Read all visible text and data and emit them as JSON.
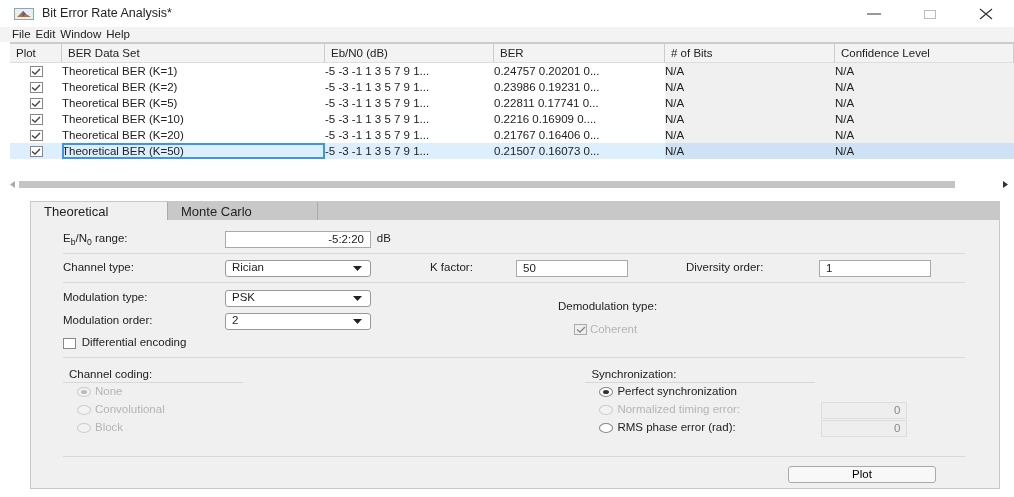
{
  "window": {
    "title": "Bit Error Rate Analysis*"
  },
  "menu": [
    "File",
    "Edit",
    "Window",
    "Help"
  ],
  "table": {
    "plot_column": "Plot",
    "columns": [
      "BER Data Set",
      "Eb/N0 (dB)",
      "BER",
      "# of Bits",
      "Confidence Level"
    ],
    "rows": [
      {
        "plot": true,
        "selected": false,
        "cells": [
          "Theoretical BER (K=1)",
          "-5 -3 -1 1 3 5 7 9 1...",
          "0.24757 0.20201 0...",
          "N/A",
          "N/A"
        ]
      },
      {
        "plot": true,
        "selected": false,
        "cells": [
          "Theoretical BER (K=2)",
          "-5 -3 -1 1 3 5 7 9 1...",
          "0.23986 0.19231 0...",
          "N/A",
          "N/A"
        ]
      },
      {
        "plot": true,
        "selected": false,
        "cells": [
          "Theoretical BER (K=5)",
          "-5 -3 -1 1 3 5 7 9 1...",
          "0.22811 0.17741 0...",
          "N/A",
          "N/A"
        ]
      },
      {
        "plot": true,
        "selected": false,
        "cells": [
          "Theoretical BER (K=10)",
          "-5 -3 -1 1 3 5 7 9 1...",
          "0.2216 0.16909 0....",
          "N/A",
          "N/A"
        ]
      },
      {
        "plot": true,
        "selected": false,
        "cells": [
          "Theoretical BER (K=20)",
          "-5 -3 -1 1 3 5 7 9 1...",
          "0.21767 0.16406 0...",
          "N/A",
          "N/A"
        ]
      },
      {
        "plot": true,
        "selected": true,
        "cells": [
          "Theoretical BER (K=50)",
          "-5 -3 -1 1 3 5 7 9 1...",
          "0.21507 0.16073 0...",
          "N/A",
          "N/A"
        ]
      }
    ]
  },
  "tabs": [
    {
      "label": "Theoretical",
      "selected": true
    },
    {
      "label": "Monte Carlo",
      "selected": false
    }
  ],
  "form": {
    "ebno": {
      "label": "E$_{b}$/N$_{0}$ range:",
      "value": "-5:2:20",
      "unit": "dB"
    },
    "channel_type": {
      "label": "Channel type:",
      "value": "Rician"
    },
    "k_factor": {
      "label": "K factor:",
      "value": "50"
    },
    "diversity_order": {
      "label": "Diversity order:",
      "value": "1"
    },
    "modulation_type": {
      "label": "Modulation type:",
      "value": "PSK"
    },
    "modulation_order": {
      "label": "Modulation order:",
      "value": "2"
    },
    "differential_encoding": {
      "label": "Differential encoding",
      "checked": false
    },
    "demodulation": {
      "title": "Demodulation type:",
      "option": {
        "label": "Coherent",
        "checked": true,
        "disabled": true
      }
    },
    "channel_coding": {
      "title": "Channel coding:",
      "options": [
        {
          "label": "None",
          "selected": true,
          "disabled": true
        },
        {
          "label": "Convolutional",
          "selected": false,
          "disabled": true
        },
        {
          "label": "Block",
          "selected": false,
          "disabled": true
        }
      ]
    },
    "synchronization": {
      "title": "Synchronization:",
      "options": [
        {
          "label": "Perfect synchronization",
          "selected": true,
          "disabled": false
        },
        {
          "label": "Normalized timing error:",
          "selected": false,
          "disabled": true,
          "value": "0",
          "field_disabled": true
        },
        {
          "label": "RMS phase error (rad):",
          "selected": false,
          "disabled": false,
          "value": "0",
          "field_disabled": true
        }
      ]
    },
    "plot_button": "Plot"
  }
}
